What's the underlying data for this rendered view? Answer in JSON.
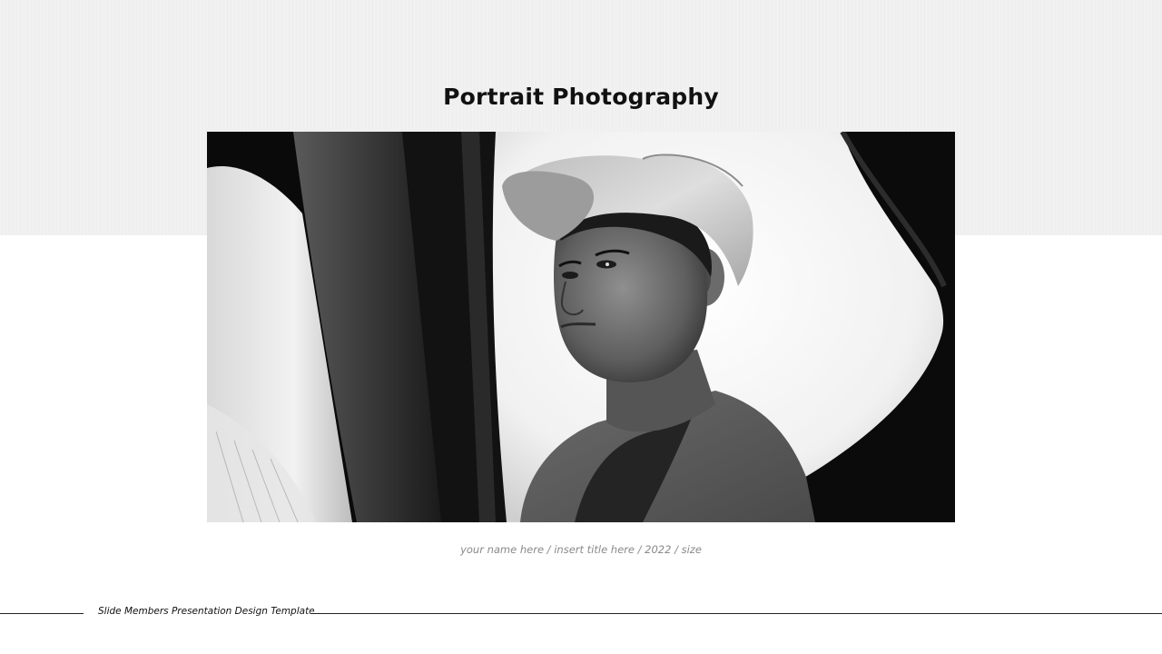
{
  "slide": {
    "title": "Portrait Photography",
    "caption": "your name here / insert title here / 2022 / size",
    "footer": "Slide Members Presentation Design Template"
  },
  "photo": {
    "subject": "black-and-white portrait of a boy in a baseball cap seen through a vehicle window",
    "colors": {
      "background_band": "#efefef",
      "title": "#111111",
      "caption": "#8a8a8a",
      "rule": "#222222"
    }
  }
}
